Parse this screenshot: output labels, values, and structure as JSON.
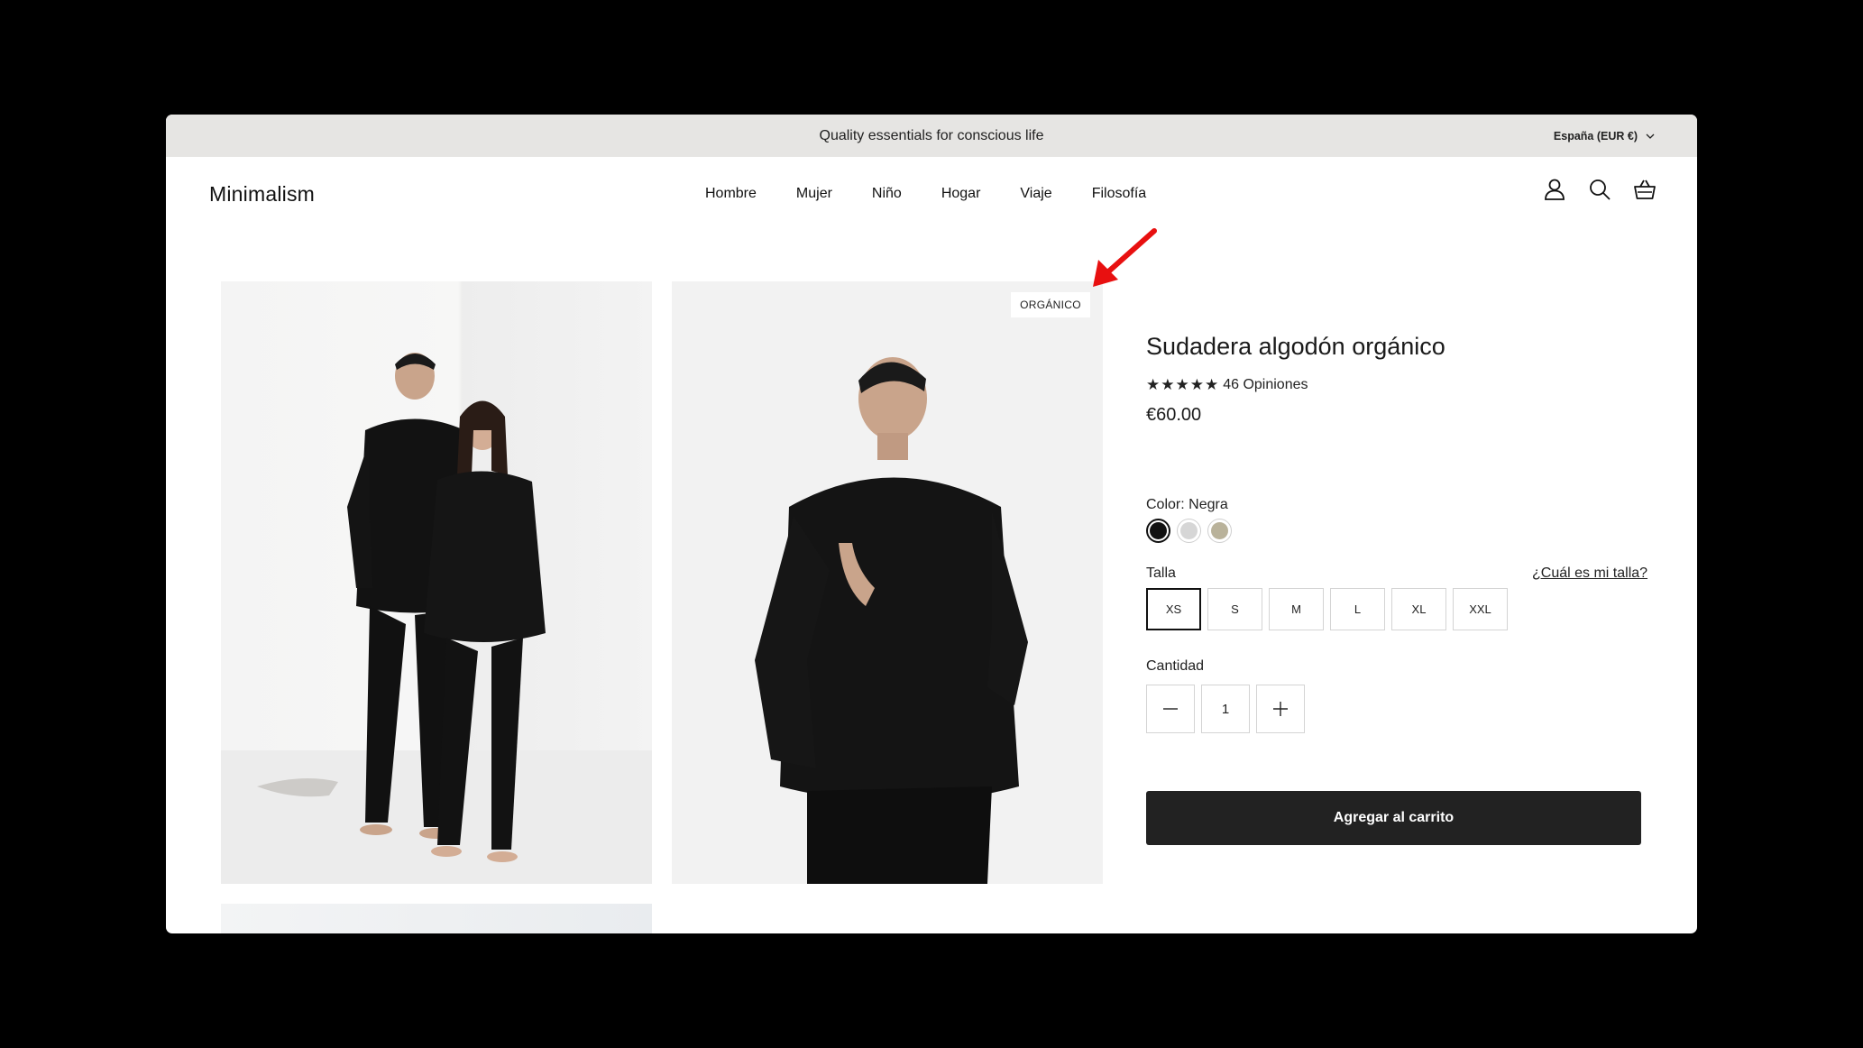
{
  "announcement": {
    "text": "Quality essentials for conscious life",
    "locale": "España (EUR €)"
  },
  "header": {
    "logo": "Minimalism",
    "nav": [
      "Hombre",
      "Mujer",
      "Niño",
      "Hogar",
      "Viaje",
      "Filosofía"
    ],
    "icons": [
      "account-icon",
      "search-icon",
      "basket-icon"
    ]
  },
  "gallery": {
    "badge": "ORGÁNICO"
  },
  "product": {
    "title": "Sudadera algodón orgánico",
    "stars": "★★★★★",
    "rating_value": 5,
    "reviews": "46 Opiniones",
    "price": "€60.00",
    "color_label": "Color:",
    "color_value": "Negra",
    "swatches": [
      {
        "name": "Negra",
        "hex": "#111111",
        "selected": true
      },
      {
        "name": "light-grey",
        "hex": "#d6d6d6",
        "selected": false
      },
      {
        "name": "sage",
        "hex": "#b9b29a",
        "selected": false
      }
    ],
    "size_label": "Talla",
    "size_guide": "¿Cuál es mi talla?",
    "sizes": [
      "XS",
      "S",
      "M",
      "L",
      "XL",
      "XXL"
    ],
    "selected_size": "XS",
    "qty_label": "Cantidad",
    "qty": "1",
    "add_to_cart": "Agregar al carrito"
  },
  "colors": {
    "announcement_bg": "#e6e5e3",
    "button_bg": "#222222",
    "annotation_arrow": "#e81010"
  }
}
